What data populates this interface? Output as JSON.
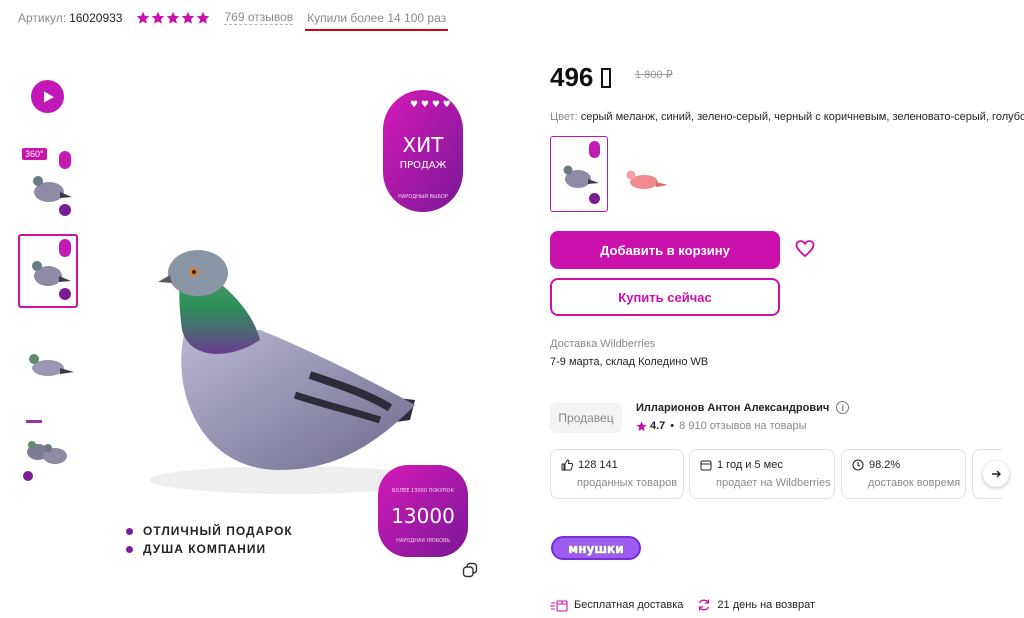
{
  "header": {
    "article_label": "Артикул:",
    "article_value": "16020933",
    "rating_stars": 5,
    "reviews_text": "769 отзывов",
    "bought_text": "Купили более 14 100 раз"
  },
  "gallery": {
    "badge_360": "360°",
    "sticker_hit_line1": "ХИТ",
    "sticker_hit_line2": "ПРОДАЖ",
    "sticker_hit_small": "НАРОДНЫЙ ВЫБОР",
    "sticker_count_top": "БОЛЕЕ 13000 ПОКУПОК",
    "sticker_count_value": "13000",
    "sticker_count_bottom": "НАРОДНАЯ ЛЮБОВЬ",
    "features": [
      "ОТЛИЧНЫЙ ПОДАРОК",
      "ДУША КОМПАНИИ"
    ]
  },
  "product": {
    "price": "496",
    "old_price": "1 800 ₽",
    "color_label": "Цвет:",
    "color_value": "серый меланж, синий, зелено-серый, черный с коричневым, зеленовато-серый, голубой",
    "add_to_cart": "Добавить в корзину",
    "buy_now": "Купить сейчас",
    "delivery_title": "Доставка Wildberries",
    "delivery_value": "7-9 марта, склад Коледино WB"
  },
  "seller": {
    "pill": "Продавец",
    "name": "Илларионов Антон Александрович",
    "rating": "4.7",
    "reviews": "8 910 отзывов на товары"
  },
  "stats": [
    {
      "top": "128 141",
      "bottom": "проданных товаров"
    },
    {
      "top": "1 год и 5 мес",
      "bottom": "продает на Wildberries"
    },
    {
      "top": "98.2%",
      "bottom": "доставок вовремя"
    }
  ],
  "footer": {
    "free_delivery": "Бесплатная доставка",
    "returns": "21 день на возврат"
  },
  "colors": {
    "accent": "#cb11ab",
    "price": "#111111",
    "muted": "#8a8a8a"
  }
}
